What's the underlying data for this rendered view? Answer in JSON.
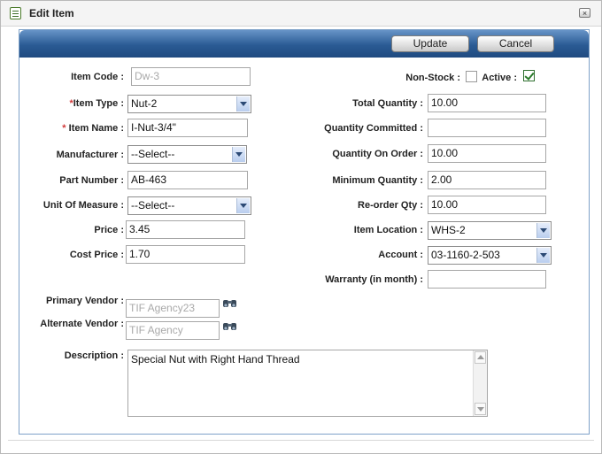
{
  "window": {
    "title": "Edit Item",
    "close_glyph": "×"
  },
  "toolbar": {
    "update_label": "Update",
    "cancel_label": "Cancel"
  },
  "colors": {
    "toolbar": "#2a5b94",
    "required": "#d23a3a"
  },
  "left": {
    "item_code": {
      "label": "Item Code :",
      "value": "Dw-3"
    },
    "item_type": {
      "req": "*",
      "label": "Item Type :",
      "value": "Nut-2"
    },
    "item_name": {
      "req": "* ",
      "label": "Item Name :",
      "value": "I-Nut-3/4\""
    },
    "manufacturer": {
      "label": "Manufacturer :",
      "value": "--Select--"
    },
    "part_number": {
      "label": "Part Number :",
      "value": "AB-463"
    },
    "unit_of_measure": {
      "label": "Unit Of Measure :",
      "value": "--Select--"
    },
    "price": {
      "label": "Price :",
      "value": "3.45"
    },
    "cost_price": {
      "label": "Cost Price :",
      "value": "1.70"
    },
    "primary_vendor": {
      "label": "Primary Vendor :",
      "value": "TIF Agency23"
    },
    "alternate_vendor": {
      "label": "Alternate Vendor :",
      "value": "TIF Agency"
    },
    "description": {
      "label": "Description :",
      "value": "Special Nut with Right Hand Thread"
    }
  },
  "right": {
    "non_stock": {
      "label": "Non-Stock :",
      "checked": false
    },
    "active": {
      "label": "Active :",
      "checked": true
    },
    "total_quantity": {
      "label": "Total Quantity :",
      "value": "10.00"
    },
    "quantity_committed": {
      "label": "Quantity Committed :",
      "value": ""
    },
    "quantity_on_order": {
      "label": "Quantity On Order :",
      "value": "10.00"
    },
    "minimum_quantity": {
      "label": "Minimum Quantity :",
      "value": "2.00"
    },
    "reorder_qty": {
      "label": "Re-order Qty :",
      "value": "10.00"
    },
    "item_location": {
      "label": "Item Location :",
      "value": "WHS-2"
    },
    "account": {
      "label": "Account :",
      "value": "03-1160-2-503"
    },
    "warranty": {
      "label": "Warranty (in month) :",
      "value": ""
    }
  },
  "icons": {
    "title_icon": "form-icon",
    "lookup_icon": "binoculars-icon",
    "close_icon": "close-icon"
  }
}
